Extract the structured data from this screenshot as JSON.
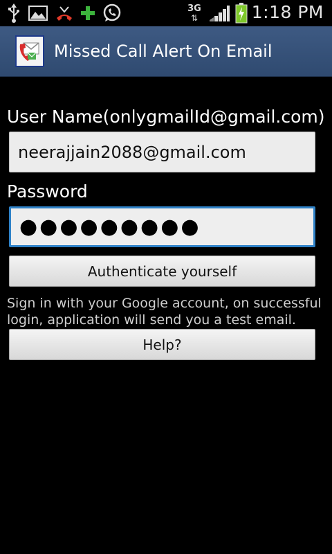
{
  "status_bar": {
    "time": "1:18 PM",
    "network_type": "3G",
    "icons": [
      "usb-icon",
      "gallery-icon",
      "missed-call-icon",
      "plus-icon",
      "whatsapp-icon",
      "signal-icon",
      "battery-charging-icon"
    ]
  },
  "app": {
    "title": "Missed Call Alert On Email",
    "icon": "phone-email-icon"
  },
  "form": {
    "username_label": "User Name(onlygmailId@gmail.com)",
    "username_value": "neerajjain2088@gmail.com",
    "password_label": "Password",
    "password_value": "●●●●●●●●●",
    "authenticate_label": "Authenticate yourself",
    "description": "Sign in with your Google account, on successful login, application will send you a test email.",
    "help_label": "Help?"
  },
  "colors": {
    "title_bar": "#36527a",
    "focus_border": "#2f82c8",
    "battery_green": "#7ec82a"
  }
}
